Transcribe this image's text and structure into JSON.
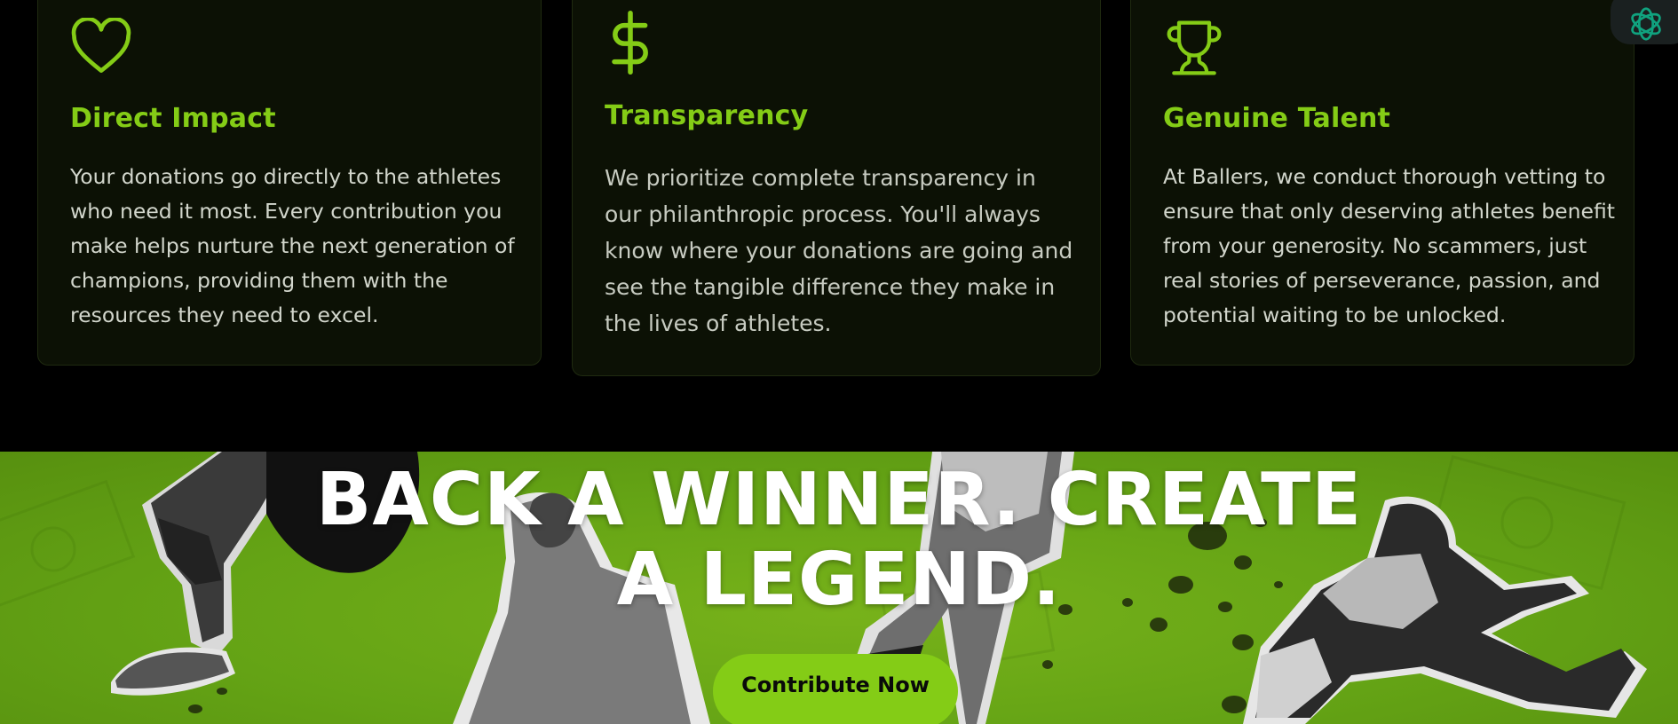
{
  "features": [
    {
      "icon": "heart-icon",
      "title": "Direct Impact",
      "body": "Your donations go directly to the athletes who need it most. Every contribution you make helps nurture the next generation of champions, providing them with the resources they need to excel."
    },
    {
      "icon": "dollar-icon",
      "title": "Transparency",
      "body": "We prioritize complete transparency in our philanthropic process. You'll always know where your donations are going and see the tangible difference they make in the lives of athletes."
    },
    {
      "icon": "trophy-icon",
      "title": "Genuine Talent",
      "body": "At Ballers, we conduct thorough vetting to ensure that only deserving athletes benefit from your generosity. No scammers, just real stories of perseverance, passion, and potential waiting to be unlocked."
    }
  ],
  "hero": {
    "headline_line1": "BACK A WINNER. CREATE",
    "headline_line2": "A LEGEND.",
    "cta_label": "Contribute Now"
  },
  "colors": {
    "accent": "#84cc16",
    "card_bg": "#0c1105",
    "page_bg": "#000000",
    "hero_bg": "#64a315"
  },
  "icons": {
    "assistant": "ai-assistant-icon"
  }
}
